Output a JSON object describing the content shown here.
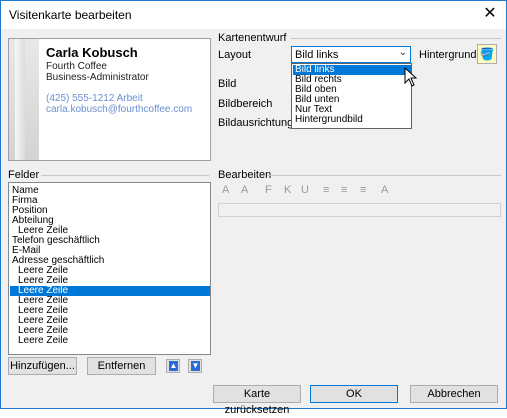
{
  "window": {
    "title": "Visitenkarte bearbeiten",
    "close": "✕"
  },
  "card": {
    "name": "Carla Kobusch",
    "company": "Fourth Coffee",
    "position": "Business-Administrator",
    "phone": "(425) 555-1212 Arbeit",
    "email": "carla.kobusch@fourthcoffee.com"
  },
  "design": {
    "group_label": "Kartenentwurf",
    "layout_label": "Layout",
    "layout_value": "Bild links",
    "background_label": "Hintergrund",
    "image_label": "Bild",
    "image_area_label": "Bildbereich",
    "image_align_label": "Bildausrichtung",
    "layout_options": [
      "Bild links",
      "Bild rechts",
      "Bild oben",
      "Bild unten",
      "Nur Text",
      "Hintergrundbild"
    ]
  },
  "fields": {
    "group_label": "Felder",
    "items": [
      "Name",
      "Firma",
      "Position",
      "Abteilung",
      "  Leere Zeile",
      "Telefon geschäftlich",
      "E-Mail",
      "Adresse geschäftlich",
      "  Leere Zeile",
      "  Leere Zeile",
      "  Leere Zeile",
      "  Leere Zeile",
      "  Leere Zeile",
      "  Leere Zeile",
      "  Leere Zeile",
      "  Leere Zeile"
    ],
    "selected_index": 10,
    "add_button": "Hinzufügen...",
    "remove_button": "Entfernen"
  },
  "edit": {
    "group_label": "Bearbeiten",
    "tools": [
      "A",
      "A",
      "F",
      "K",
      "U",
      "≡",
      "≡",
      "≡",
      "A"
    ]
  },
  "buttons": {
    "reset": "Karte zurücksetzen",
    "ok": "OK",
    "cancel": "Abbrechen"
  }
}
